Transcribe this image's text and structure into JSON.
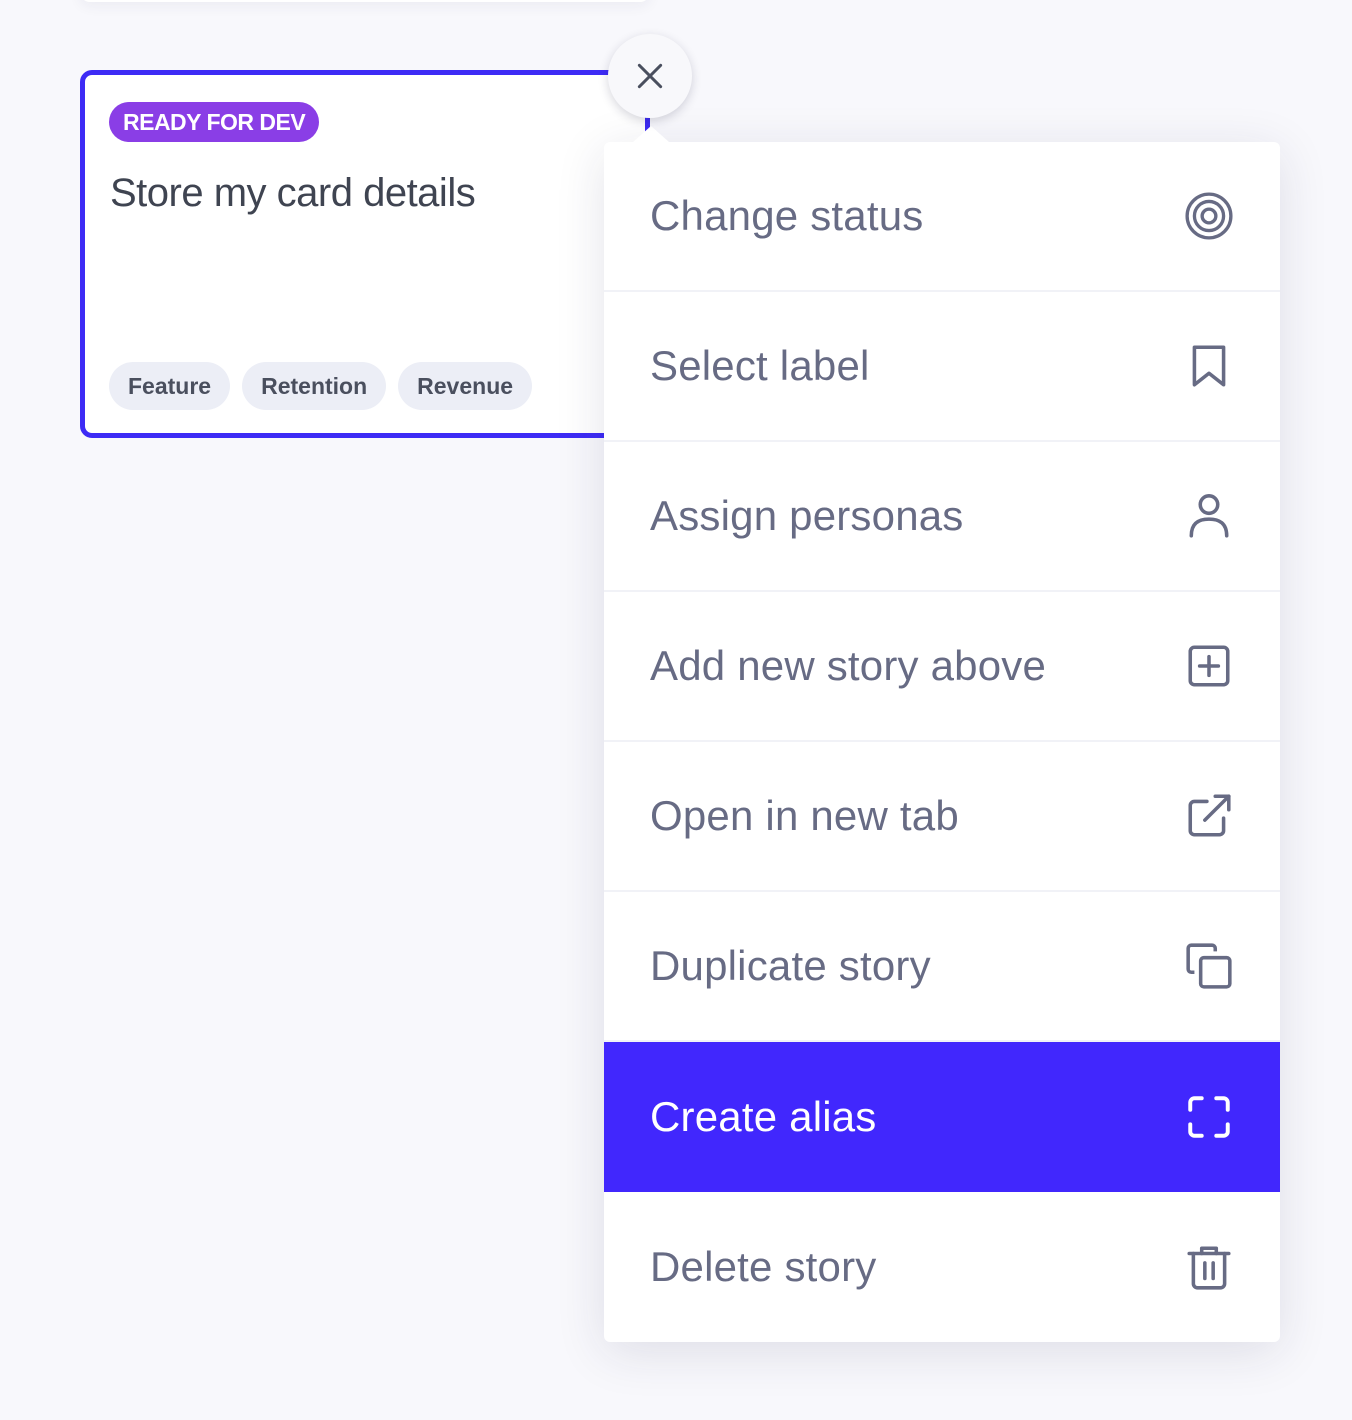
{
  "card": {
    "status": "READY FOR DEV",
    "title": "Store my card details",
    "tags": [
      "Feature",
      "Retention",
      "Revenue"
    ]
  },
  "close_icon": "close-icon",
  "menu": {
    "items": [
      {
        "label": "Change status",
        "icon": "target-icon"
      },
      {
        "label": "Select label",
        "icon": "bookmark-icon"
      },
      {
        "label": "Assign personas",
        "icon": "user-icon"
      },
      {
        "label": "Add new story above",
        "icon": "plus-square-icon"
      },
      {
        "label": "Open in new tab",
        "icon": "external-link-icon"
      },
      {
        "label": "Duplicate story",
        "icon": "copy-icon"
      },
      {
        "label": "Create alias",
        "icon": "alias-frame-icon",
        "active": true
      },
      {
        "label": "Delete story",
        "icon": "trash-icon"
      }
    ]
  },
  "colors": {
    "accent": "#4127fd",
    "card_border": "#3d2bf5",
    "status_badge": "#8a3ee6",
    "menu_text": "#676b84"
  }
}
